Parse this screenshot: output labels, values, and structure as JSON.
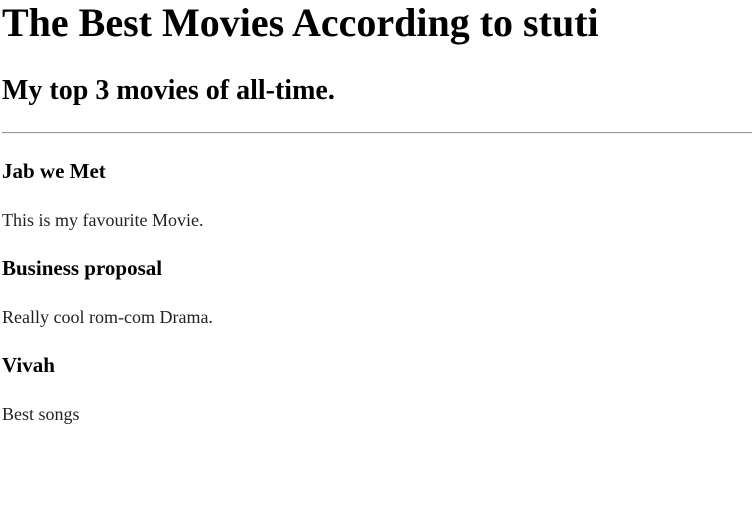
{
  "page": {
    "title": "The Best Movies According to stuti",
    "subtitle": "My top 3 movies of all-time."
  },
  "movies": [
    {
      "title": "Jab we Met",
      "description": "This is my favourite Movie."
    },
    {
      "title": "Business proposal",
      "description": "Really cool rom-com Drama."
    },
    {
      "title": "Vivah",
      "description": "Best songs"
    }
  ]
}
